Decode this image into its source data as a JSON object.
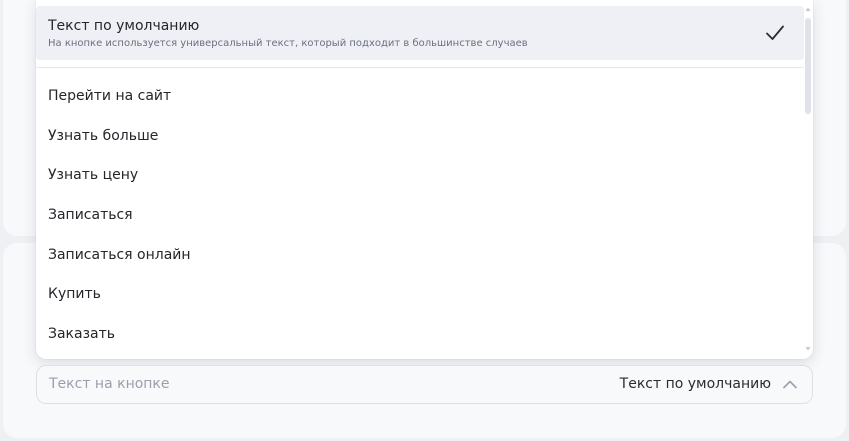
{
  "dropdown": {
    "selected": {
      "title": "Текст по умолчанию",
      "subtitle": "На кнопке используется универсальный текст, который подходит в большинстве случаев"
    },
    "options": [
      "Перейти на сайт",
      "Узнать больше",
      "Узнать цену",
      "Записаться",
      "Записаться онлайн",
      "Купить",
      "Заказать"
    ]
  },
  "field": {
    "label": "Текст на кнопке",
    "value": "Текст по умолчанию"
  },
  "colors": {
    "page_bg": "#eef0f4",
    "card_bg": "#f8f9fb",
    "selected_bg": "#eef0f5",
    "text": "#24262b",
    "muted": "#9a9fab"
  },
  "icons": {
    "selected_marker": "check-icon",
    "field_toggle": "chevron-up-icon"
  }
}
